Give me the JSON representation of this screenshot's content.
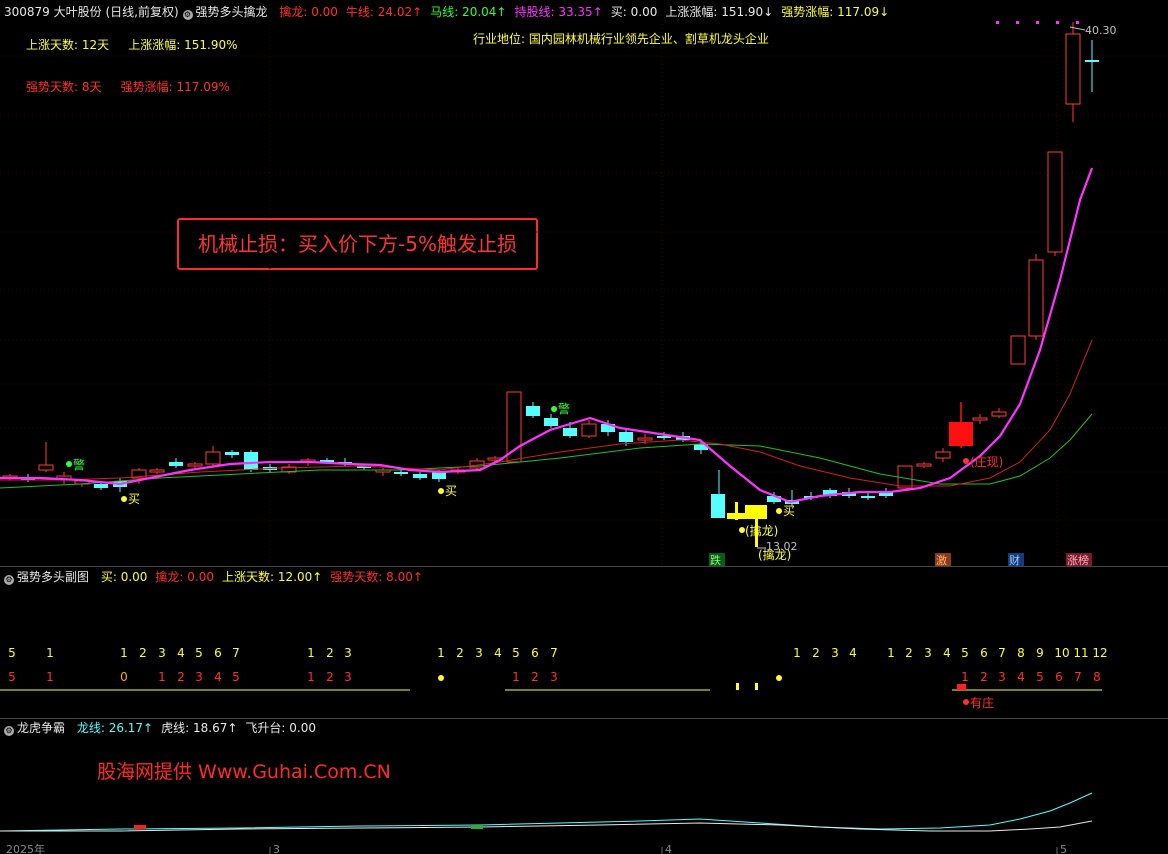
{
  "header": {
    "stock_code": "300879",
    "stock_name": "大叶股份",
    "period": "(日线,前复权)",
    "indicator_name": "强势多头擒龙",
    "items": [
      {
        "label": "擒龙:",
        "value": "0.00",
        "color": "#ff3030"
      },
      {
        "label": "牛线:",
        "value": "24.02↑",
        "color": "#ff3030"
      },
      {
        "label": "马线:",
        "value": "20.04↑",
        "color": "#33ff33"
      },
      {
        "label": "持股线:",
        "value": "33.35↑",
        "color": "#ff33ff"
      },
      {
        "label": "买:",
        "value": "0.00",
        "color": "#e8e8e8"
      },
      {
        "label": "上涨涨幅:",
        "value": "151.90↓",
        "color": "#e8e8e8"
      },
      {
        "label": "强势涨幅:",
        "value": "117.09↓",
        "color": "#ffff33"
      }
    ]
  },
  "info": {
    "up_days_label": "上涨天数:",
    "up_days_value": "12天",
    "up_gain_label": "上涨涨幅:",
    "up_gain_value": "151.90%",
    "strong_days_label": "强势天数:",
    "strong_days_value": "8天",
    "strong_gain_label": "强势涨幅:",
    "strong_gain_value": "117.09%",
    "industry_label": "行业地位:",
    "industry_value": "国内园林机械行业领先企业、割草机龙头企业"
  },
  "annotation": {
    "stop_loss": "机械止损：买入价下方-5%触发止损",
    "high_price": "40.30",
    "low_price": "13.02"
  },
  "markers": {
    "warn": "警",
    "buy": "买",
    "qinlong": "(擒龙)",
    "qinlong_cut": "(擒龙)",
    "zhuangxian": "(庄现)",
    "die": "跌",
    "ji": "激",
    "cai": "财",
    "zhangbang": "涨榜"
  },
  "sub_panel": {
    "title": "强势多头副图",
    "items": [
      {
        "label": "买:",
        "value": "0.00",
        "color": "#ffff33"
      },
      {
        "label": "擒龙:",
        "value": "0.00",
        "color": "#ff3030"
      },
      {
        "label": "上涨天数:",
        "value": "12.00↑",
        "color": "#ffff33"
      },
      {
        "label": "强势天数:",
        "value": "8.00↑",
        "color": "#ff3030"
      }
    ],
    "row1": [
      "5",
      "1",
      "1",
      "2",
      "3",
      "4",
      "5",
      "6",
      "7",
      "1",
      "2",
      "3",
      "1",
      "2",
      "3",
      "4",
      "5",
      "6",
      "7",
      "1",
      "2",
      "3",
      "4",
      "1",
      "2",
      "3",
      "4",
      "5",
      "6",
      "7",
      "8",
      "9",
      "10",
      "11",
      "12"
    ],
    "row2": [
      "5",
      "1",
      "0",
      "1",
      "2",
      "3",
      "4",
      "5",
      "1",
      "2",
      "3",
      "1",
      "2",
      "3",
      "1",
      "2",
      "3",
      "4",
      "5",
      "6",
      "7",
      "8"
    ],
    "youzhuang": "有庄"
  },
  "bottom_panel": {
    "title": "龙虎争霸",
    "items": [
      {
        "label": "龙线:",
        "value": "26.17↑",
        "color": "#55ffff"
      },
      {
        "label": "虎线:",
        "value": "18.67↑",
        "color": "#e8e8e8"
      },
      {
        "label": "飞升台:",
        "value": "0.00",
        "color": "#e8e8e8"
      }
    ],
    "watermark": "股海网提供 Www.Guhai.Com.CN",
    "xaxis": [
      "2025年",
      "3",
      "4",
      "5"
    ]
  },
  "colors": {
    "up": "#ff3b3b",
    "down": "#55ffff",
    "ma_magenta": "#ff33ff",
    "ma_red": "#d02020",
    "ma_green": "#22c022",
    "qinlong": "#ffff00"
  }
}
